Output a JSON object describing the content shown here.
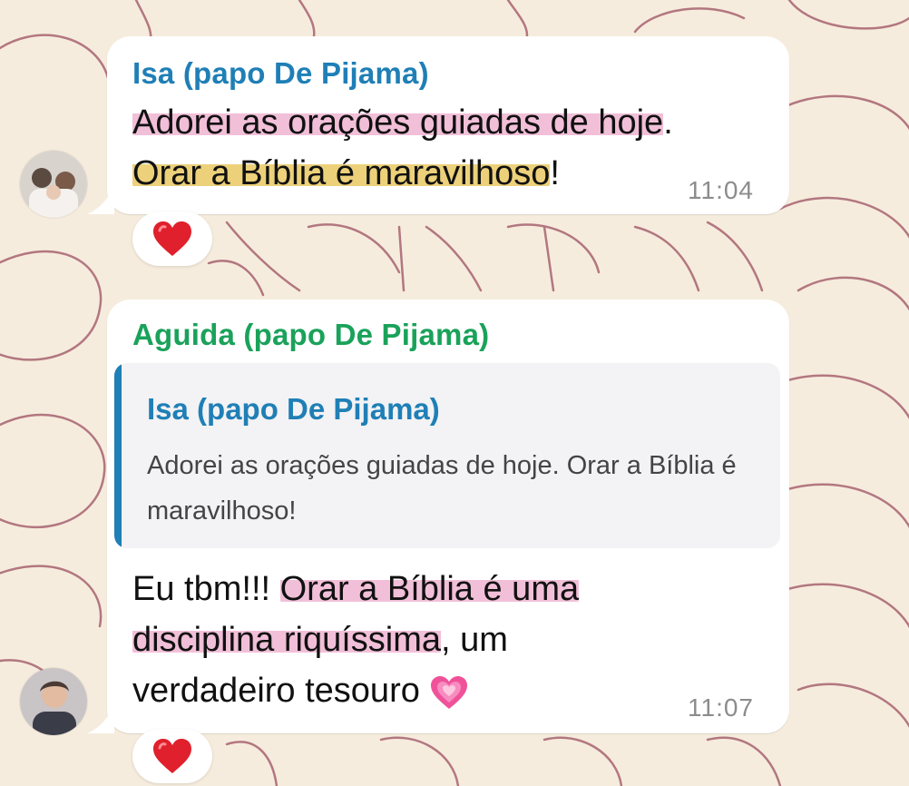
{
  "messages": [
    {
      "sender": "Isa (papo De Pijama)",
      "lines": [
        {
          "hl_pink": "Adorei as orações guiadas de hoje",
          "rest": "."
        },
        {
          "hl_yellow": "Orar a Bíblia é maravilhoso",
          "rest": "!"
        }
      ],
      "time": "11:04",
      "reaction": "red-heart"
    },
    {
      "sender": "Aguida (papo De Pijama)",
      "quoted": {
        "sender": "Isa (papo De Pijama)",
        "text": "Adorei as orações guiadas de hoje. Orar a Bíblia é maravilhoso!"
      },
      "lines": [
        {
          "pre": "Eu tbm!!! ",
          "hl_pink": "Orar a Bíblia é uma"
        },
        {
          "hl_pink": "disciplina riquíssima",
          "rest": ", um"
        },
        {
          "pre": "verdadeiro tesouro "
        }
      ],
      "time": "11:07",
      "reaction": "red-heart",
      "inline_emoji": "growing-heart"
    }
  ],
  "colors": {
    "sender_blue": "#1f7fb6",
    "sender_green": "#1aa25a",
    "highlight_pink": "#f1bfd8",
    "highlight_yellow": "#ecd17a",
    "wallpaper": "#f6ecdd"
  }
}
